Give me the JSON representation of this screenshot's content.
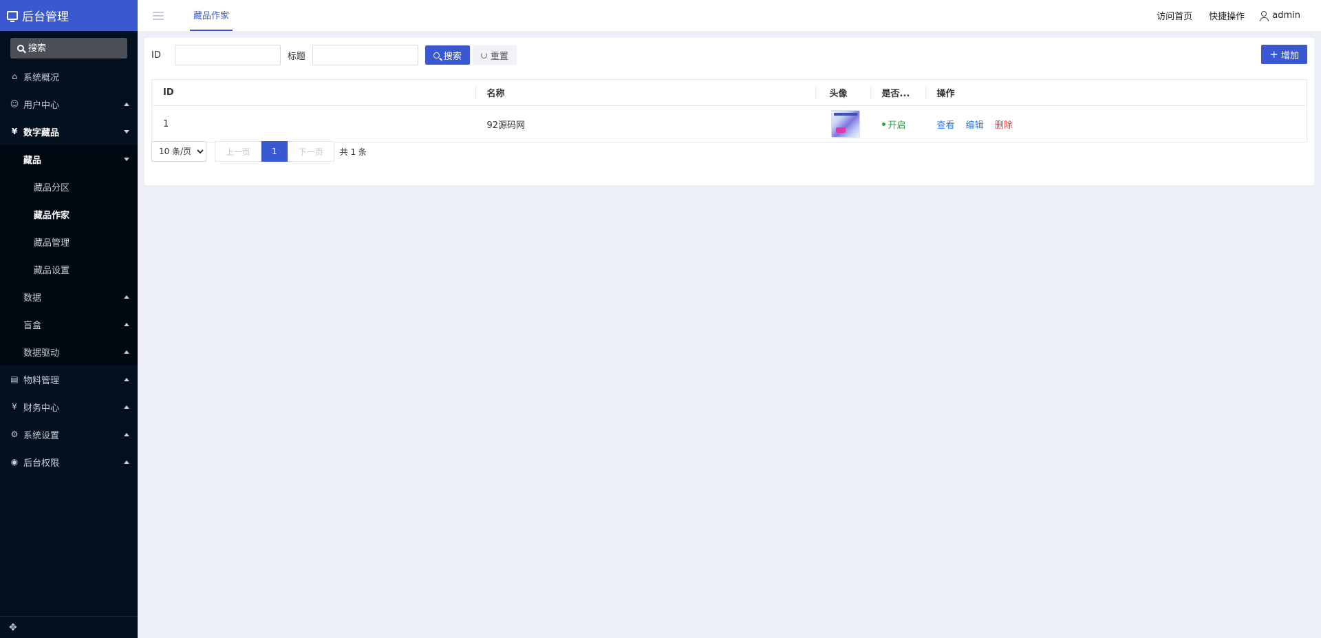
{
  "brand": {
    "title": "后台管理"
  },
  "sidebar": {
    "search_placeholder": "搜索",
    "menu": [
      {
        "icon": "home-icon",
        "label": "系统概况"
      },
      {
        "icon": "users-icon",
        "label": "用户中心"
      },
      {
        "icon": "yen-icon",
        "label": "数字藏品"
      },
      {
        "label": "藏品"
      },
      {
        "label": "藏品分区"
      },
      {
        "label": "藏品作家"
      },
      {
        "label": "藏品管理"
      },
      {
        "label": "藏品设置"
      },
      {
        "label": "数据"
      },
      {
        "label": "盲盒"
      },
      {
        "label": "数据驱动"
      },
      {
        "icon": "document-icon",
        "label": "物料管理"
      },
      {
        "icon": "yen-icon",
        "label": "财务中心"
      },
      {
        "icon": "gear-icon",
        "label": "系统设置"
      },
      {
        "icon": "user-circle-icon",
        "label": "后台权限"
      }
    ]
  },
  "header": {
    "tab": "藏品作家",
    "links": {
      "visit_home": "访问首页",
      "quick_ops": "快捷操作",
      "user": "admin"
    }
  },
  "toolbar": {
    "id_label": "ID",
    "title_label": "标题",
    "search_btn": "搜索",
    "reset_btn": "重置",
    "add_btn": "增加"
  },
  "table": {
    "columns": {
      "id": "ID",
      "name": "名称",
      "avatar": "头像",
      "enabled": "是否...",
      "actions": "操作"
    },
    "rows": [
      {
        "id": "1",
        "name": "92源码网",
        "status": "开启",
        "view": "查看",
        "edit": "编辑",
        "delete": "删除"
      }
    ]
  },
  "pager": {
    "page_size": "10 条/页",
    "prev": "上一页",
    "current": "1",
    "next": "下一页",
    "total": "共 1 条"
  },
  "colors": {
    "accent": "#3a59d1",
    "sidebar_bg": "#03101f",
    "success": "#2e9e4a",
    "danger": "#e5423a",
    "link": "#2f7dea"
  }
}
